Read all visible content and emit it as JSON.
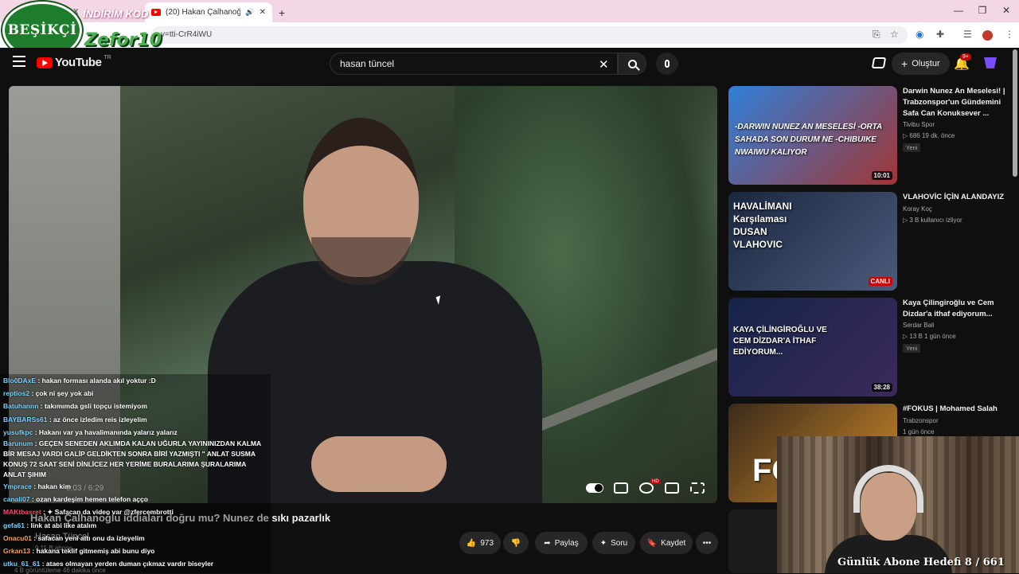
{
  "browser": {
    "tab_prev": "a / X",
    "tab_active": "(20) Hakan Çalhanoğlu iddi",
    "url": "v=tti-CrR4iWU",
    "new_tab": "+"
  },
  "overlay": {
    "logo_text": "BEŞİKÇİ",
    "brand": "Zefor10",
    "promo": "İNDİRİM KOD"
  },
  "header": {
    "logo_text": "YouTube",
    "country": "TR",
    "search_value": "hasan tüncel",
    "create_label": "Oluştur",
    "notif_count": "9+"
  },
  "player": {
    "time": "0:03 / 6:29"
  },
  "chat": [
    {
      "user": "Blo0DAxE",
      "text": ": hakan forması alanda akıl yoktur :D"
    },
    {
      "user": "reptios2",
      "text": ": çok ni şey yok abi"
    },
    {
      "user": "Batuhannn",
      "text": ": takımımda gsli topçu istemiyom"
    },
    {
      "user": "BAYBARSs61",
      "text": ": az önce izledim reis izleyelim"
    },
    {
      "user": "yusufkpc",
      "text": ": Hakanı var ya havalimanında yalarız yalarız"
    },
    {
      "user": "Barunum",
      "text": ": GEÇEN SENEDEN AKLIMDA KALAN UĞURLA YAYININIZDAN KALMA BİR MESAJ VARDI GALİP GELDİKTEN SONRA BİRİ YAZMIŞTI \" ANLAT SUSMA KONUŞ 72 SAAT SENİ DİNLİCEZ HER YERİME BURALARIMA ŞURALARIMA ANLAT ŞIHIM"
    },
    {
      "user": "Ymprace",
      "text": ": hakan kim"
    },
    {
      "user": "canali07",
      "text": ": ozan kardeşim hemen telefon açço"
    },
    {
      "user": "MAKtbasret",
      "text": ": ✦ Safacan da video var @zfercembrotti"
    },
    {
      "user": "gefa61",
      "text": ": link at abi like atalım"
    },
    {
      "user": "Onacu01",
      "text": ": safacan yeni attı onu da izleyelim"
    },
    {
      "user": "Grkan13",
      "text": ": hakana teklif gitmemiş abi bunu diyo"
    },
    {
      "user": "utku_61_61",
      "text": ": ataes olmayan yerden duman çıkmaz vardır biseyler"
    }
  ],
  "video": {
    "title": "Hakan Çalhanoğlu iddiaları doğru mu? Nunez de sıkı pazarlık",
    "channel": "Hasan Tüncel",
    "subs": "9.11 B abone",
    "views": "4 B görüntüleme  46 dakika önce",
    "likes": "973",
    "share_label": "Paylaş",
    "ask_label": "Soru",
    "save_label": "Kaydet"
  },
  "recommendations": [
    {
      "title": "Darwin Nunez An Meselesi! | Trabzonspor'un Gündemini Safa Can Konuksever ...",
      "channel": "Tivibu Spor",
      "meta": "▷ 686  19 dk. önce",
      "badge": "Yeni",
      "duration": "10:01",
      "thumb_text": "-DARWIN NUNEZ AN MESELESİ -ORTA SAHADA SON DURUM NE -CHIBUIKE NWAIWU KALIYOR"
    },
    {
      "title": "VLAHOVİC İÇİN ALANDAYIZ",
      "channel": "Koray Koç",
      "meta": "▷ 3 B kullanıcı izliyor",
      "badge": "",
      "duration": "CANLI",
      "thumb_text": "HAVALİMANI Karşılaması DUSAN VLAHOVIC"
    },
    {
      "title": "Kaya Çilingiroğlu ve Cem Dizdar'a ithaf ediyorum...",
      "channel": "Serdar Bali",
      "meta": "▷ 13 B  1 gün önce",
      "badge": "Yeni",
      "duration": "38:28",
      "thumb_text": "KAYA ÇİLİNGİROĞLU VE CEM DİZDAR'A İTHAF EDİYORUM..."
    },
    {
      "title": "#FOKUS | Mohamed Salah",
      "channel": "Trabzonspor",
      "meta": "1 gün önce",
      "badge": "",
      "duration": "",
      "thumb_text": "FO"
    }
  ],
  "webcam": {
    "goal_text": "Günlük Abone Hedefi 8 / 661"
  },
  "colors": {
    "accent_red": "#ff0000",
    "background": "#0f0f0f",
    "tab_bar": "#f4d7e6"
  }
}
